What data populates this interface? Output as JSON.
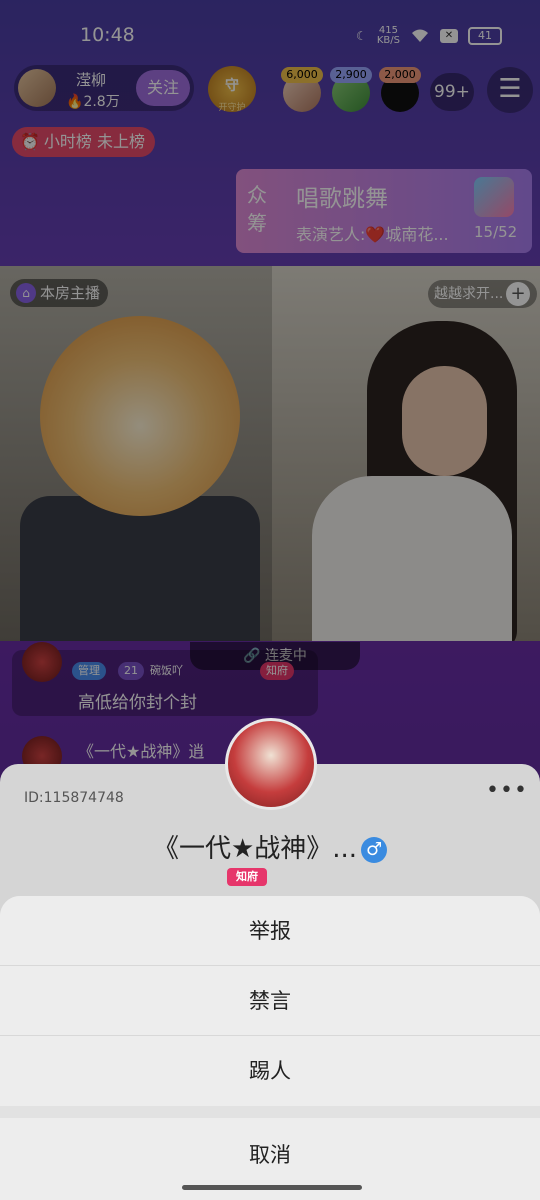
{
  "status_bar": {
    "time": "10:48",
    "net_speed_value": "415",
    "net_speed_unit": "KB/S",
    "battery": "41",
    "icons": [
      "moon-icon",
      "wifi-icon",
      "sim-off-icon",
      "battery-icon"
    ]
  },
  "host": {
    "name": "滢柳",
    "fans": "2.8万",
    "follow_label": "关注"
  },
  "guard": {
    "label": "守",
    "sub": "开守护"
  },
  "top_viewers": [
    {
      "score": "6,000",
      "color": "#f2c14a"
    },
    {
      "score": "2,900",
      "color": "#9aa8ff"
    },
    {
      "score": "2,000",
      "color": "#f29a7a"
    }
  ],
  "viewer_count": "99+",
  "hour_rank": "小时榜 未上榜",
  "crowdfund": {
    "tag": "众筹",
    "title": "唱歌跳舞",
    "subtitle": "表演艺人:❤️城南花...",
    "progress": "15/52"
  },
  "video": {
    "room_host_label": "本房主播",
    "guest_label": "越越求开...",
    "link_status": "连麦中"
  },
  "chat": {
    "msg1_badge_admin": "管理",
    "msg1_level": "21",
    "msg1_nick": "碗饭吖",
    "msg1_badge_shop": "知府",
    "msg1_text": "高低给你封个封",
    "msg2_name": "《一代★战神》逍"
  },
  "user_card": {
    "id_text": "ID:115874748",
    "name": "《一代★战神》...",
    "gender_symbol": "♂",
    "badge": "知府",
    "more_label": "•••"
  },
  "action_sheet": {
    "report": "举报",
    "mute": "禁言",
    "kick": "踢人",
    "cancel": "取消"
  }
}
